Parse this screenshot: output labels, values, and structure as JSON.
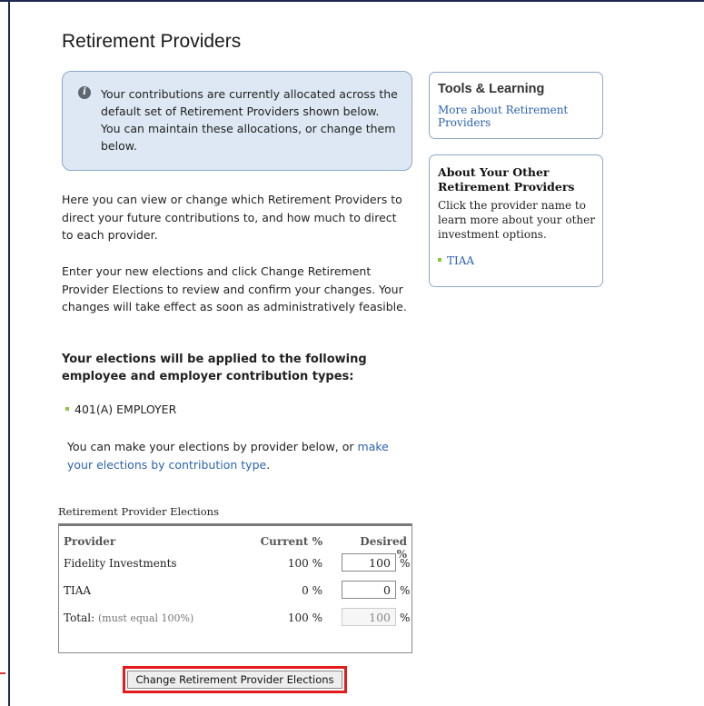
{
  "page": {
    "title": "Retirement Providers"
  },
  "info": {
    "text": "Your contributions are currently allocated across the default set of Retirement Providers shown below.  You can maintain these allocations, or change them below."
  },
  "body": {
    "p1": "Here you can view or change which Retirement Providers to direct your future contributions to, and how much to direct to each provider.",
    "p2": "Enter your new elections and click Change Retirement Provider Elections to review and confirm your changes. Your changes will take effect as soon as administratively feasible.",
    "p3": "Your elections will be applied to the following employee and employer contribution types:",
    "contribution_types": [
      "401(A) EMPLOYER"
    ],
    "p4_prefix": "You can make your elections by provider below, or ",
    "p4_link": "make your elections by contribution type",
    "p4_suffix": "."
  },
  "table": {
    "caption": "Retirement Provider Elections",
    "headers": {
      "provider": "Provider",
      "current": "Current %",
      "desired": "Desired %"
    },
    "rows": [
      {
        "provider": "Fidelity Investments",
        "current": "100 %",
        "desired": "100",
        "unit": "%"
      },
      {
        "provider": "TIAA",
        "current": "0 %",
        "desired": "0",
        "unit": "%"
      }
    ],
    "total": {
      "label": "Total:",
      "note": "(must equal 100%)",
      "current": "100 %",
      "desired": "100",
      "unit": "%"
    }
  },
  "submit": {
    "label": "Change Retirement Provider Elections"
  },
  "sidebar": {
    "tools": {
      "title": "Tools & Learning",
      "link": "More about Retirement Providers"
    },
    "other": {
      "title": "About Your Other Retirement Providers",
      "body": "Click the provider name to learn more about your other investment options.",
      "items": [
        "TIAA"
      ]
    }
  },
  "colors": {
    "accent_link": "#2c63b1",
    "bullet": "#8cc63f",
    "highlight": "#e21b1b",
    "info_bg": "#dde8f4"
  }
}
